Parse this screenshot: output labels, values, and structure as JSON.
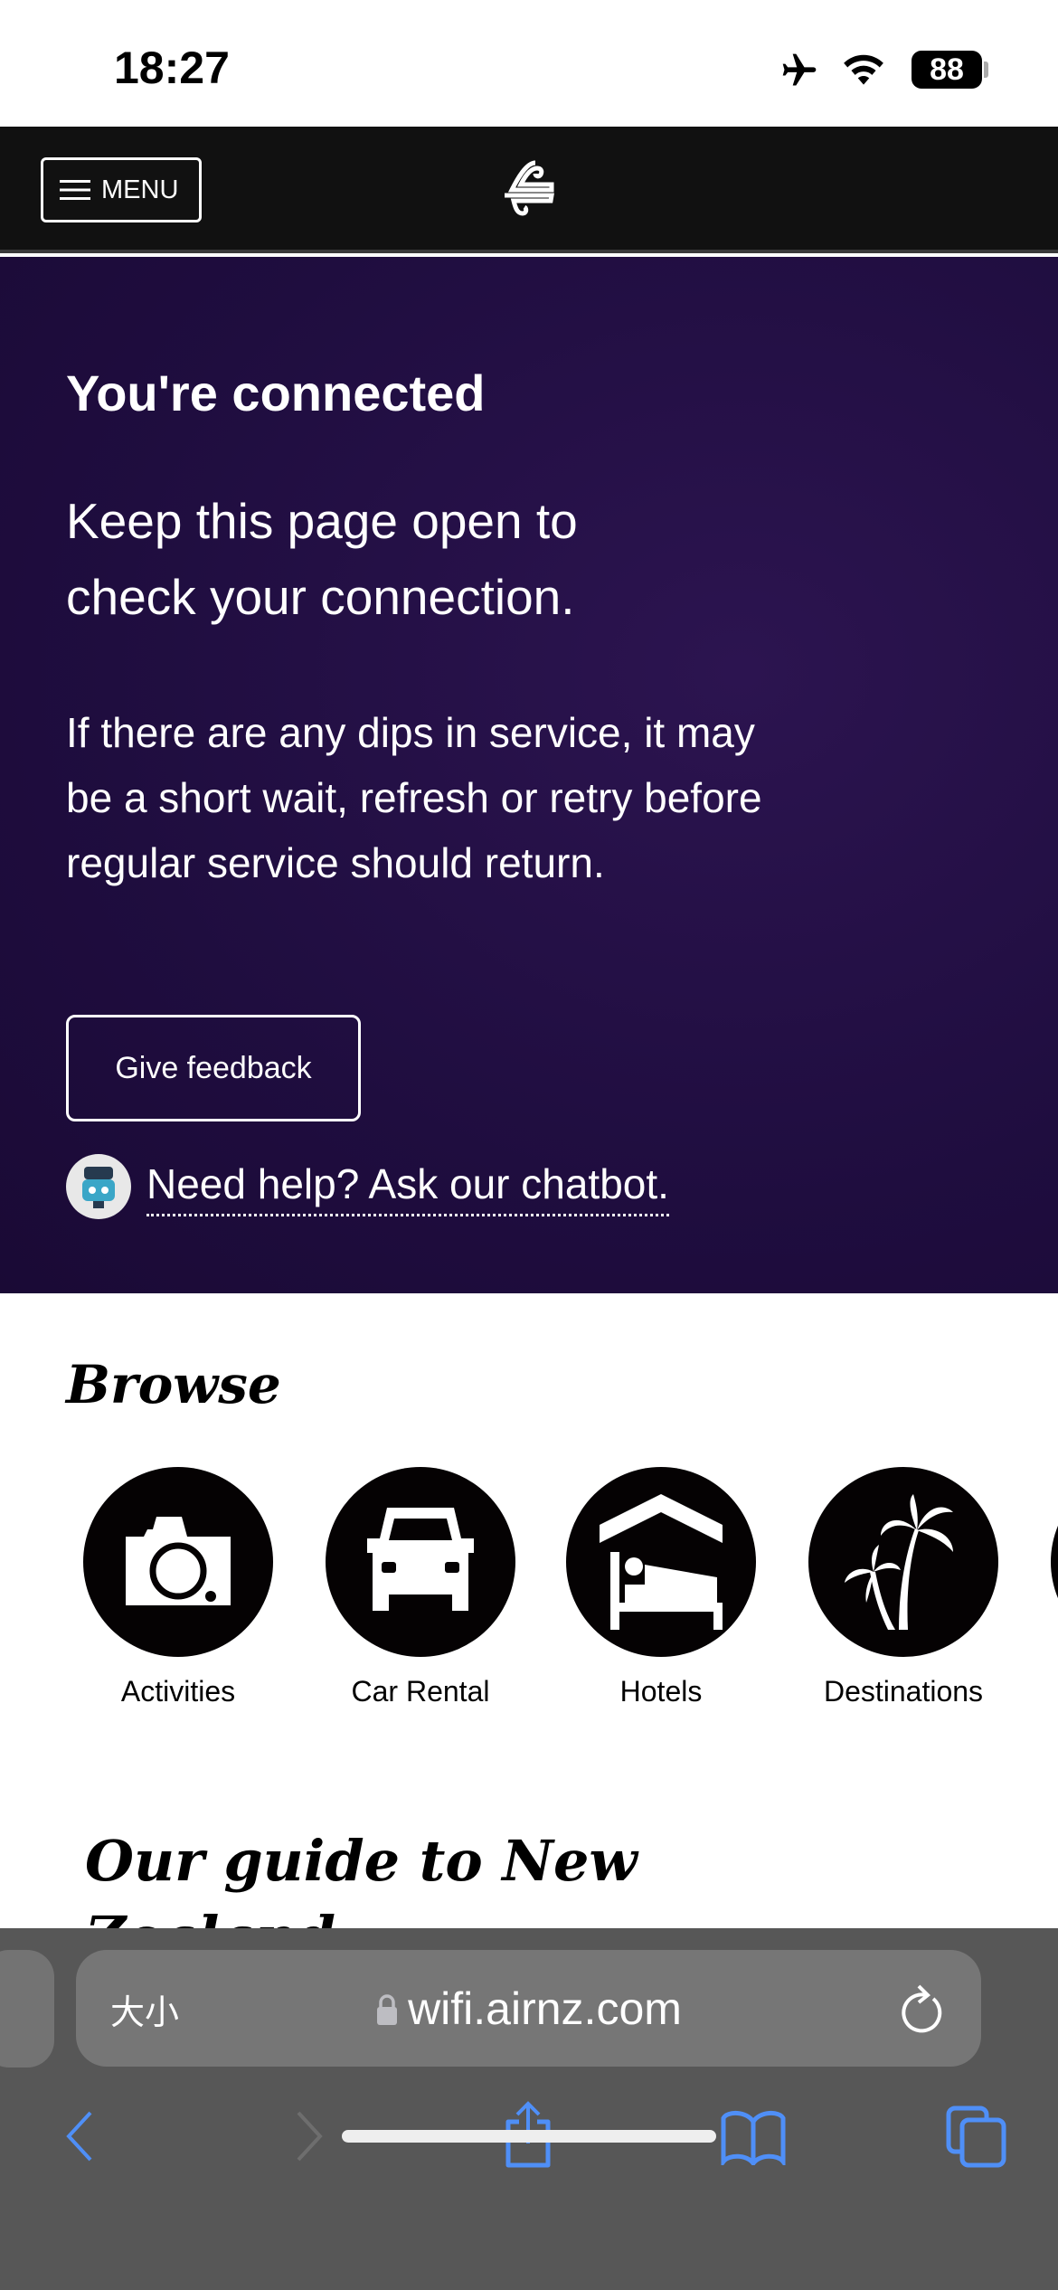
{
  "status_bar": {
    "time": "18:27",
    "battery": "88",
    "icons": [
      "airplane-icon",
      "wifi-icon",
      "battery-icon"
    ]
  },
  "nav": {
    "menu_label": "MENU",
    "logo": "Air New Zealand koru logo"
  },
  "hero": {
    "title": "You're connected",
    "subtitle": "Keep this page open to check your connection.",
    "body": "If there are any dips in service, it may be a short wait, refresh or retry before regular service should return.",
    "feedback_label": "Give feedback",
    "chatbot_label": "Need help? Ask our chatbot.",
    "background": "#1f0d3f"
  },
  "browse": {
    "title": "Browse",
    "items": [
      {
        "label": "Activities",
        "icon": "camera-icon"
      },
      {
        "label": "Car Rental",
        "icon": "car-icon"
      },
      {
        "label": "Hotels",
        "icon": "bed-icon"
      },
      {
        "label": "Destinations",
        "icon": "palm-tree-icon"
      }
    ]
  },
  "guide": {
    "title": "Our guide to New Zealand"
  },
  "browser": {
    "text_size_label": "大小",
    "url": "wifi.airnz.com",
    "accent": "#4f8ff7"
  }
}
